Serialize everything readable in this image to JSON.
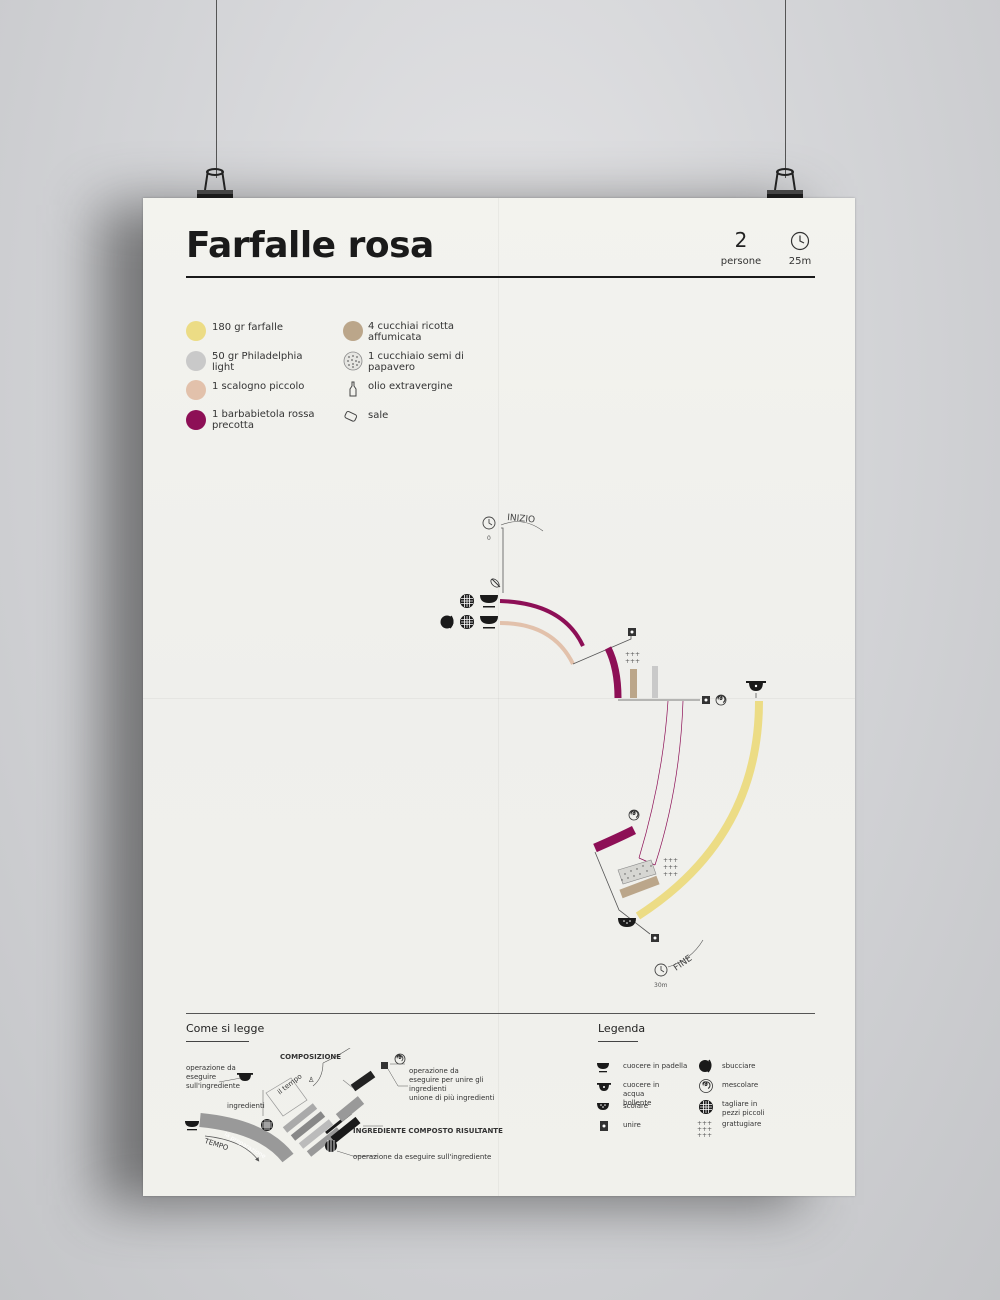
{
  "recipe": {
    "title": "Farfalle rosa",
    "servings_value": "2",
    "servings_label": "persone",
    "time_label": "25m"
  },
  "ingredients": [
    {
      "label": "180 gr farfalle",
      "color": "#ecdc85",
      "icon": "circle"
    },
    {
      "label": "50 gr Philadelphia light",
      "color": "#c9c9c9",
      "icon": "circle"
    },
    {
      "label": "1 scalogno piccolo",
      "color": "#e2c1ab",
      "icon": "circle"
    },
    {
      "label": "1 barbabietola rossa precotta",
      "color": "#8d0f56",
      "icon": "circle"
    },
    {
      "label": "4 cucchiai ricotta affumicata",
      "color": "#bba68a",
      "icon": "circle"
    },
    {
      "label": "1 cucchiaio semi di papavero",
      "color": "#999999",
      "icon": "poppy-seed-icon"
    },
    {
      "label": "olio extravergine",
      "color": "#555555",
      "icon": "oil-bottle-icon"
    },
    {
      "label": "sale",
      "color": "#555555",
      "icon": "salt-icon"
    }
  ],
  "timeline": {
    "start_label": "INIZIO",
    "start_time": "0",
    "end_label": "FINE",
    "end_time": "30m"
  },
  "how_to_read": {
    "title": "Come si legge",
    "labels": {
      "operation_ingredient": "operazione da eseguire sull'ingrediente",
      "composition": "COMPOSIZIONE",
      "ingredients": "ingredienti",
      "time_flow": "il tempo",
      "time": "TEMPO",
      "preparation": "la preparazione",
      "operation_union": "operazione da eseguire per unire gli ingredienti",
      "union": "unione di più ingredienti",
      "result": "INGREDIENTE COMPOSTO RISULTANTE",
      "operation_bottom": "operazione da eseguire sull'ingrediente"
    }
  },
  "legend": {
    "title": "Legenda",
    "items": [
      {
        "label": "cuocere in padella",
        "icon": "pan-icon"
      },
      {
        "label": "sbucciare",
        "icon": "peel-icon"
      },
      {
        "label": "cuocere in acqua bollente",
        "icon": "pot-icon"
      },
      {
        "label": "mescolare",
        "icon": "spiral-icon"
      },
      {
        "label": "scolare",
        "icon": "colander-icon"
      },
      {
        "label": "tagliare in pezzi piccoli",
        "icon": "grid-cut-icon"
      },
      {
        "label": "unire",
        "icon": "join-icon"
      },
      {
        "label": "grattugiare",
        "icon": "grate-icon"
      }
    ]
  },
  "colors": {
    "farfalle": "#ecdc85",
    "philadelphia": "#c9c9c9",
    "scalogno": "#e2c1ab",
    "barbabietola": "#8d0f56",
    "ricotta": "#bba68a",
    "poppy": "#888888"
  }
}
